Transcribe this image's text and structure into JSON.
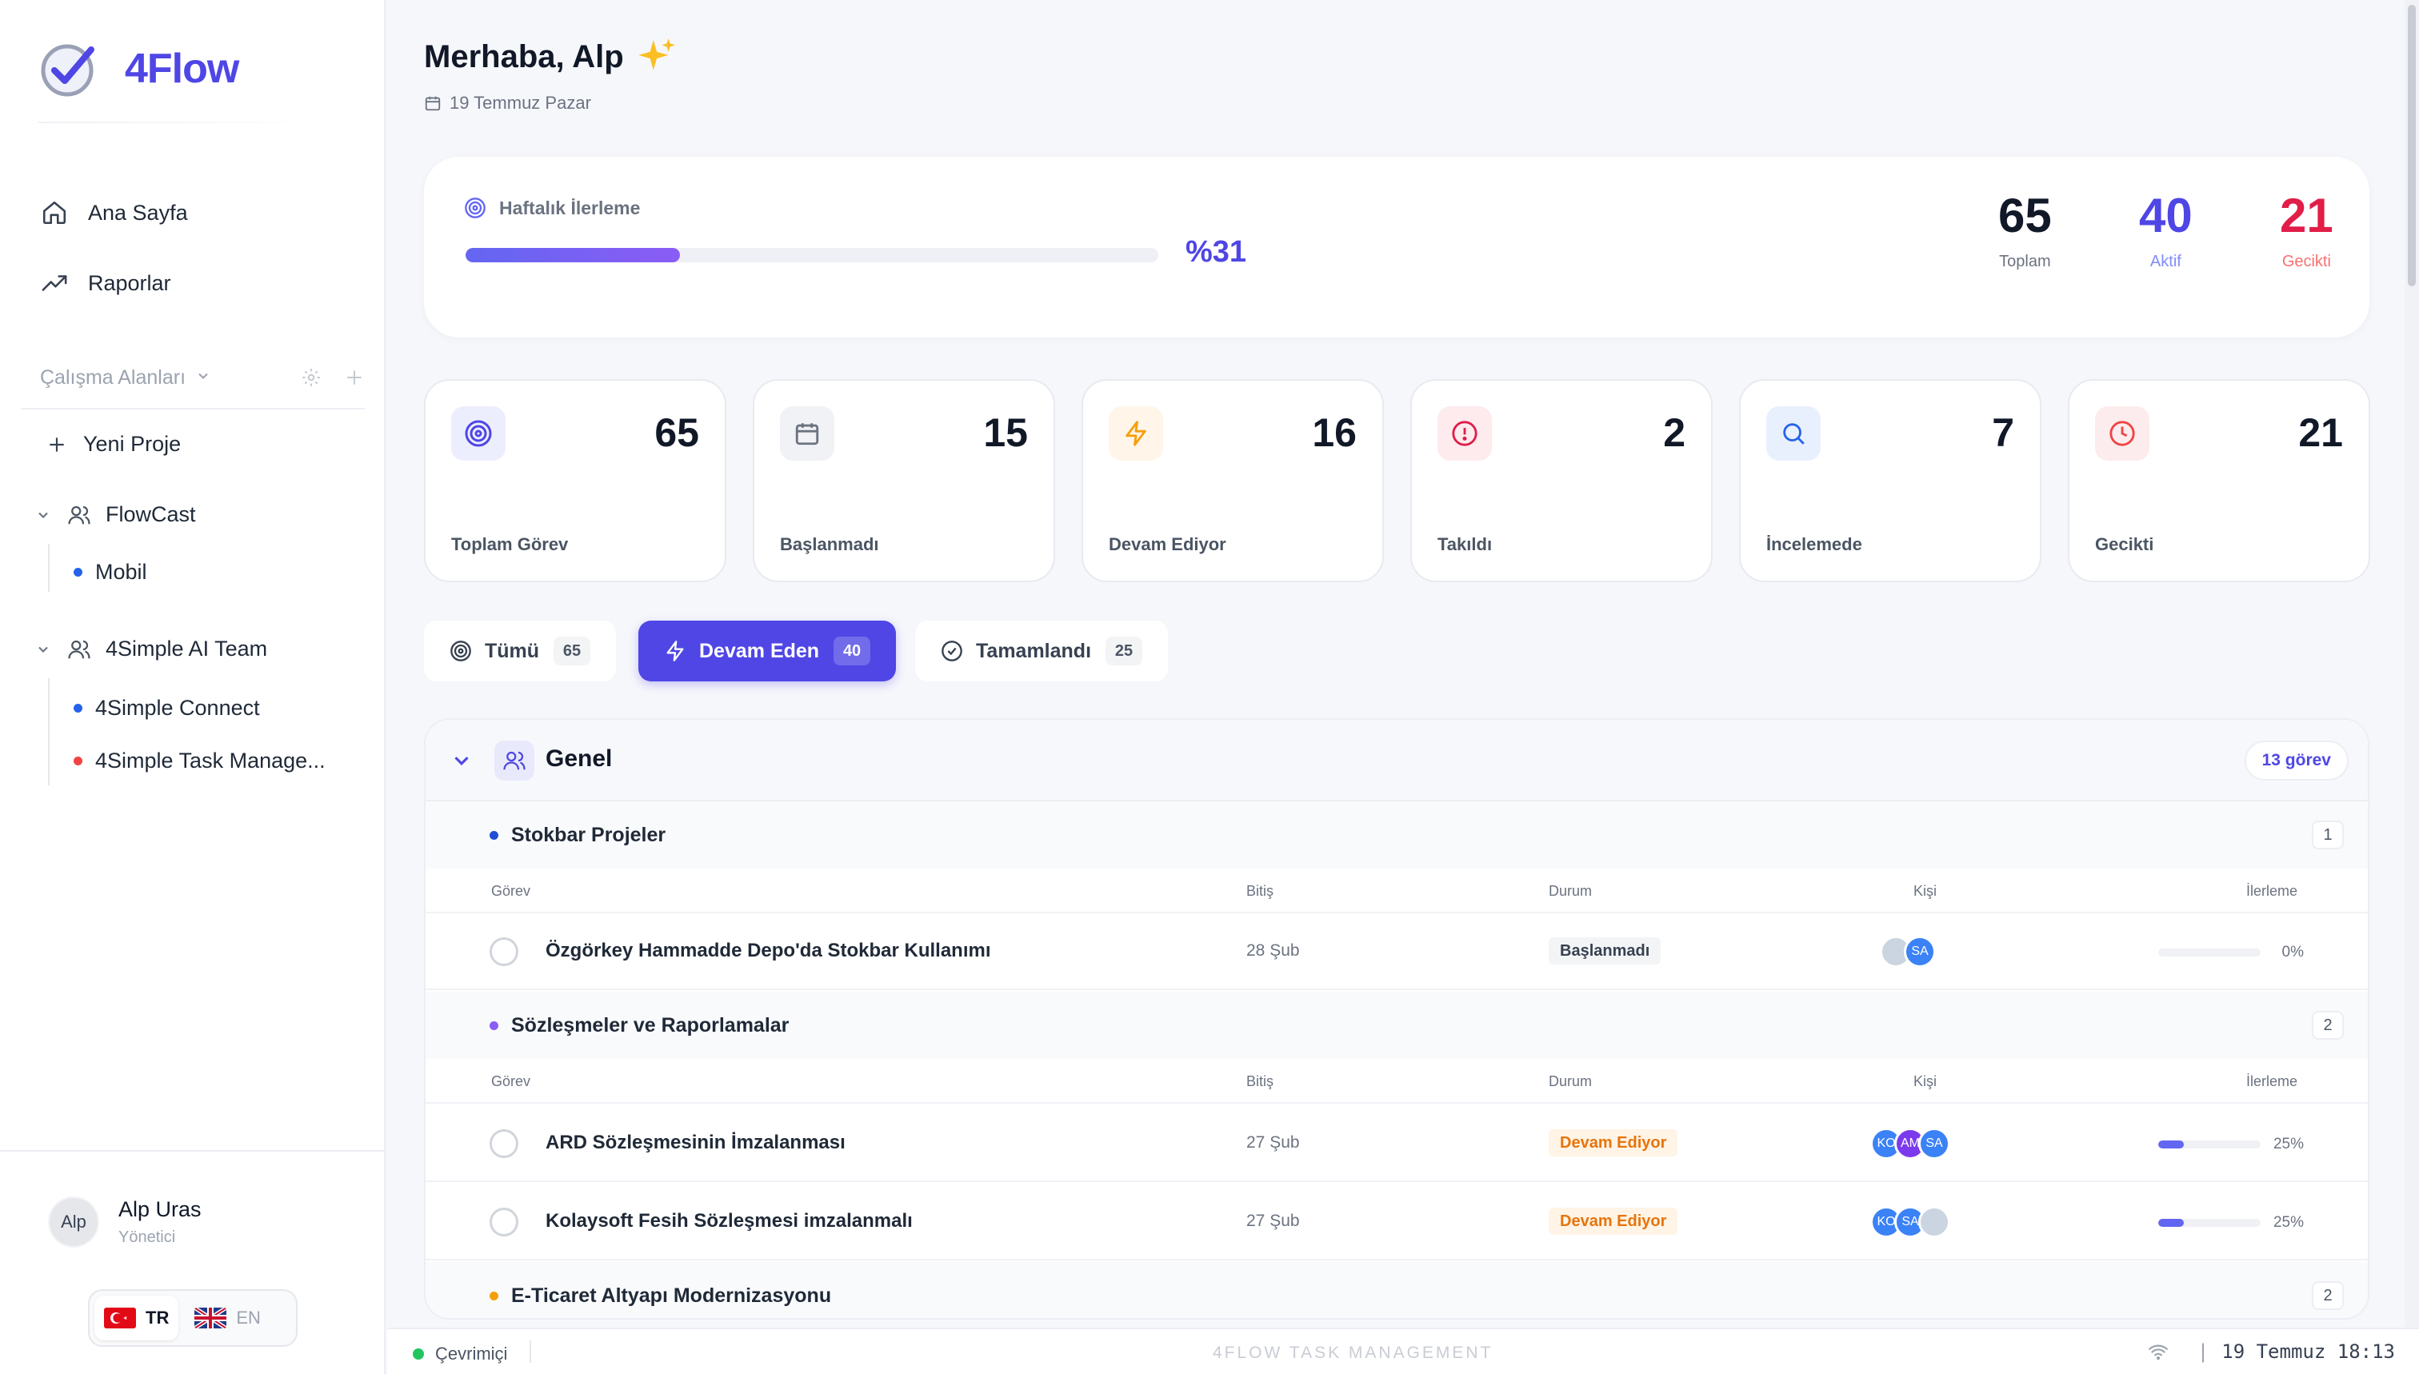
{
  "sidebar": {
    "logo_text": "4Flow",
    "nav": [
      {
        "label": "Ana Sayfa",
        "icon": "home-icon"
      },
      {
        "label": "Raporlar",
        "icon": "trending-up-icon"
      }
    ],
    "workspaces_label": "Çalışma Alanları",
    "new_project": "Yeni Proje",
    "workspaces": [
      {
        "name": "FlowCast",
        "projects": [
          {
            "name": "Mobil",
            "color": "#2563eb"
          }
        ]
      },
      {
        "name": "4Simple AI Team",
        "projects": [
          {
            "name": "4Simple Connect",
            "color": "#2563eb"
          },
          {
            "name": "4Simple Task Manage...",
            "color": "#ef4444"
          }
        ]
      }
    ],
    "user": {
      "name": "Alp Uras",
      "role": "Yönetici",
      "avatar_alt": "Alp"
    },
    "languages": [
      {
        "code": "TR",
        "active": true
      },
      {
        "code": "EN",
        "active": false
      }
    ]
  },
  "header": {
    "greeting": "Merhaba, Alp",
    "date": "19 Temmuz Pazar"
  },
  "weekly": {
    "label": "Haftalık İlerleme",
    "percent_text": "%31",
    "percent": 31,
    "stats": [
      {
        "value": "65",
        "label": "Toplam",
        "color": "#111827",
        "label_color": "#6b7280"
      },
      {
        "value": "40",
        "label": "Aktif",
        "color": "#4f46e5",
        "label_color": "#818cf8"
      },
      {
        "value": "21",
        "label": "Gecikti",
        "color": "#e11d48",
        "label_color": "#f87171"
      }
    ]
  },
  "stat_cards": [
    {
      "value": "65",
      "label": "Toplam Görev",
      "icon": "target-icon",
      "color": "#4f46e5",
      "bg": "#eceefe"
    },
    {
      "value": "15",
      "label": "Başlanmadı",
      "icon": "calendar-icon",
      "color": "#6b7280",
      "bg": "#f1f2f5"
    },
    {
      "value": "16",
      "label": "Devam Ediyor",
      "icon": "lightning-icon",
      "color": "#f59e0b",
      "bg": "#fff5e8"
    },
    {
      "value": "2",
      "label": "Takıldı",
      "icon": "alert-circle-icon",
      "color": "#e11d48",
      "bg": "#fdebee"
    },
    {
      "value": "7",
      "label": "İncelemede",
      "icon": "search-icon",
      "color": "#2563eb",
      "bg": "#e8f0fe"
    },
    {
      "value": "21",
      "label": "Gecikti",
      "icon": "clock-icon",
      "color": "#ef4444",
      "bg": "#fdeced"
    }
  ],
  "filter_tabs": [
    {
      "label": "Tümü",
      "count": "65",
      "active": false
    },
    {
      "label": "Devam Eden",
      "count": "40",
      "active": true
    },
    {
      "label": "Tamamlandı",
      "count": "25",
      "active": false
    }
  ],
  "group": {
    "title": "Genel",
    "badge": "13 görev",
    "columns": {
      "task": "Görev",
      "due": "Bitiş",
      "status": "Durum",
      "people": "Kişi",
      "progress": "İlerleme"
    },
    "projects": [
      {
        "name": "Stokbar Projeler",
        "count": "1",
        "color": "#1d4ed8",
        "tasks": [
          {
            "name": "Özgörkey Hammadde Depo'da Stokbar Kullanımı",
            "due": "28 Şub",
            "status": "Başlanmadı",
            "progress_text": "0%",
            "progress": 0,
            "people": [
              {
                "initials": "",
                "color": "#cbd5e1"
              },
              {
                "initials": "SA",
                "color": "#3b82f6"
              }
            ]
          }
        ]
      },
      {
        "name": "Sözleşmeler ve Raporlamalar",
        "count": "2",
        "color": "#8b5cf6",
        "tasks": [
          {
            "name": "ARD Sözleşmesinin İmzalanması",
            "due": "27 Şub",
            "status": "Devam Ediyor",
            "progress_text": "25%",
            "progress": 25,
            "people": [
              {
                "initials": "KO",
                "color": "#3b82f6"
              },
              {
                "initials": "AM",
                "color": "#7c3aed"
              },
              {
                "initials": "SA",
                "color": "#3b82f6"
              }
            ]
          },
          {
            "name": "Kolaysoft Fesih Sözleşmesi imzalanmalı",
            "due": "27 Şub",
            "status": "Devam Ediyor",
            "progress_text": "25%",
            "progress": 25,
            "people": [
              {
                "initials": "KO",
                "color": "#3b82f6"
              },
              {
                "initials": "SA",
                "color": "#3b82f6"
              },
              {
                "initials": "",
                "color": "#cbd5e1"
              }
            ]
          }
        ]
      },
      {
        "name": "E-Ticaret Altyapı Modernizasyonu",
        "count": "2",
        "color": "#f59e0b",
        "tasks": []
      }
    ]
  },
  "footer": {
    "status": "Çevrimiçi",
    "brand": "4FLOW TASK MANAGEMENT",
    "separator": "|",
    "datetime": "19 Temmuz 18:13"
  }
}
